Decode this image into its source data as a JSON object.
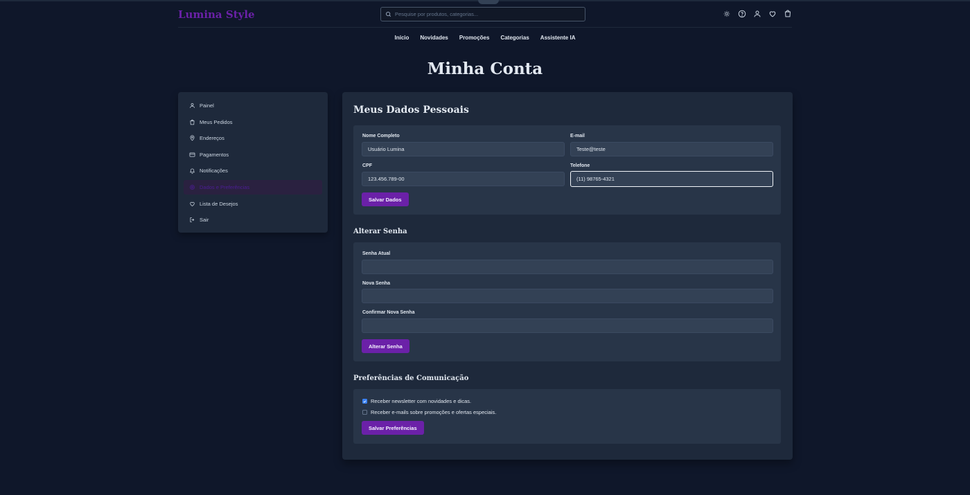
{
  "header": {
    "logo": "Lumina Style",
    "search_placeholder": "Pesquise por produtos, categorias...",
    "icons": [
      "sun-icon",
      "help-icon",
      "user-icon",
      "heart-icon",
      "shopping-bag-icon"
    ]
  },
  "nav": {
    "items": [
      "Início",
      "Novidades",
      "Promoções",
      "Categorias",
      "Assistente IA"
    ]
  },
  "page": {
    "title": "Minha Conta"
  },
  "sidebar": {
    "items": [
      {
        "label": "Painel",
        "icon": "user-icon"
      },
      {
        "label": "Meus Pedidos",
        "icon": "shopping-bag-icon"
      },
      {
        "label": "Endereços",
        "icon": "map-pin-icon"
      },
      {
        "label": "Pagamentos",
        "icon": "credit-card-icon"
      },
      {
        "label": "Notificações",
        "icon": "bell-icon"
      },
      {
        "label": "Dados e Preferências",
        "icon": "settings-icon",
        "active": true
      },
      {
        "label": "Lista de Desejos",
        "icon": "heart-icon"
      },
      {
        "label": "Sair",
        "icon": "logout-icon"
      }
    ]
  },
  "personal": {
    "title": "Meus Dados Pessoais",
    "name_label": "Nome Completo",
    "name_value": "Usuário Lumina",
    "email_label": "E-mail",
    "email_value": "Teste@teste",
    "cpf_label": "CPF",
    "cpf_value": "123.456.789-00",
    "phone_label": "Telefone",
    "phone_value": "(11) 98765-4321",
    "save_label": "Salvar Dados"
  },
  "password": {
    "title": "Alterar Senha",
    "current_label": "Senha Atual",
    "new_label": "Nova Senha",
    "confirm_label": "Confirmar Nova Senha",
    "button_label": "Alterar Senha"
  },
  "preferences": {
    "title": "Preferências de Comunicação",
    "newsletter_label": "Receber newsletter com novidades e dicas.",
    "newsletter_checked": true,
    "promos_label": "Receber e-mails sobre promoções e ofertas especiais.",
    "promos_checked": false,
    "button_label": "Salvar Preferências"
  },
  "colors": {
    "background": "#0f172a",
    "panel": "#1e293b",
    "card": "#283548",
    "accent": "#6b21a8",
    "checkbox": "#3b82f6"
  }
}
